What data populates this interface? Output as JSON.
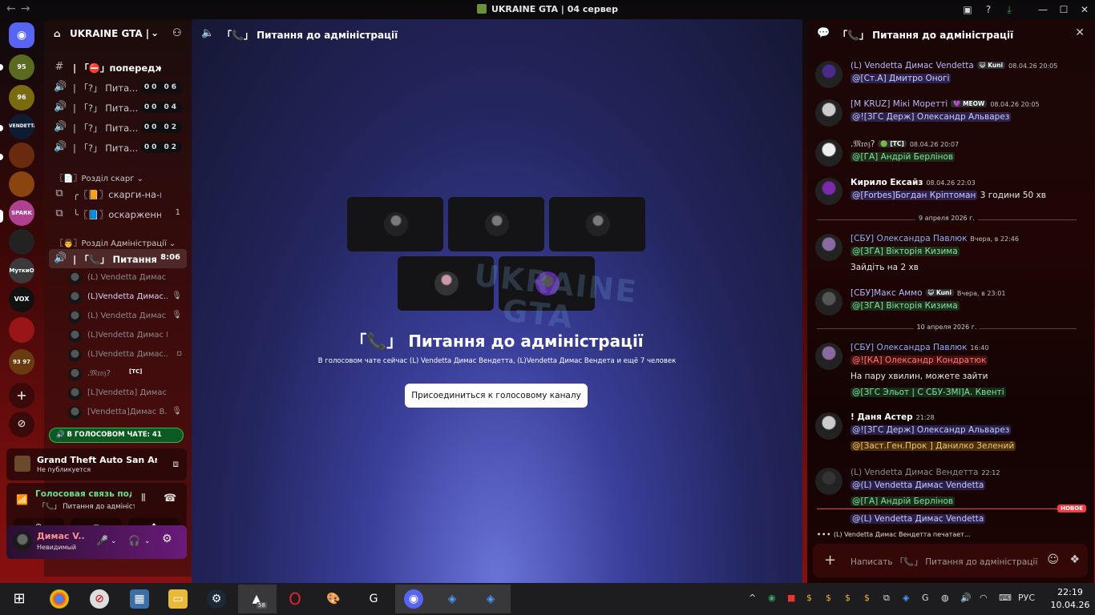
{
  "window": {
    "title": "UKRAINE GTA | 04 сервер",
    "back": "←",
    "forward": "→",
    "min": "—",
    "max": "☐",
    "close": "✕"
  },
  "rail": {
    "servers": [
      "95",
      "96",
      "VENDETTA",
      "",
      "",
      "SPARK",
      "",
      "МуткиО",
      "VOX",
      "",
      "93 97"
    ]
  },
  "guild": {
    "name": "UKRAINE GTA | ..."
  },
  "channels": [
    {
      "icon": "#",
      "label": "| 「⛔」попередження",
      "badge": ""
    },
    {
      "icon": "🔊",
      "label": "| 「?」 Пита...",
      "badge": "00 06"
    },
    {
      "icon": "🔊",
      "label": "| 「?」 Пита...",
      "badge": "00 04"
    },
    {
      "icon": "🔊",
      "label": "| 「?」 Пита...",
      "badge": "00 02"
    },
    {
      "icon": "🔊",
      "label": "| 「?」 Пита...",
      "badge": "00 02"
    }
  ],
  "category1": "〖📄〗Розділ скарг ⌄",
  "threads": [
    {
      "label": "╭〖📙〗скарги-на-гр...",
      "count": ""
    },
    {
      "label": "╰〖📘〗оскарженн...",
      "count": "1"
    }
  ],
  "category2": "〖👨〗Розділ Адміністрації ⌄",
  "active_channel": {
    "label": "| 「📞」 Питання ...",
    "time": "8:06"
  },
  "voice_users": [
    {
      "name": "(L) Vendetta Димас Ве...",
      "status": "",
      "bright": false
    },
    {
      "name": "(L)Vendetta Димас...",
      "status": "🎤̸",
      "bright": true
    },
    {
      "name": "(L) Vendetta Димас Ве...",
      "status": "🎤̸",
      "bright": false
    },
    {
      "name": "(L)Vendetta Димас Вен...",
      "status": "",
      "bright": false
    },
    {
      "name": "(L)Vendetta Димас...",
      "status": "▫",
      "bright": false
    },
    {
      "name": ".𝔐𝔯𝔬𝔷?",
      "status": "",
      "bright": false,
      "tag": "[TC]"
    },
    {
      "name": "[L]Vendetta] Димас Ве...",
      "status": "",
      "bright": false
    },
    {
      "name": "[Vendetta]Димас В...",
      "status": "🎤̸",
      "bright": false
    }
  ],
  "voice_pill": "🔊 В ГОЛОСОВОМ ЧАТЕ: 41",
  "activity": {
    "title": "Grand Theft Auto San Andr...",
    "sub": "Не публикуется"
  },
  "voice_conn": {
    "title": "Голосовая связь подкл...",
    "sub": "「📞」 Питання до адміністр..."
  },
  "user": {
    "name": "Димас V...",
    "status": "Невидимый"
  },
  "main": {
    "header": "「📞」 Питання до адміністрації",
    "title": "「📞」 Питання до адміністрації",
    "desc": "В голосовом чате сейчас (L) Vendetta Димас Вендетта, (L)Vendetta Димас Вендета и ещё 7 человек",
    "join": "Присоединиться к голосовому каналу",
    "watermark_line1": "UKRAINE",
    "watermark_line2": "GTA"
  },
  "chat": {
    "header": "「📞」 Питання до адміністрації",
    "messages": [
      {
        "author": "(L) Vendetta Димас Vendetta",
        "tag": "😺 Kuni",
        "time": "08.04.26 20:05",
        "lines": [
          [
            {
              "t": "@[Ст.А] Дмитро Оногі",
              "k": "mention"
            }
          ]
        ]
      },
      {
        "author": "[M KRUZ] Мікі Моретті",
        "tag": "💜 MEOW",
        "time": "08.04.26 20:05",
        "lines": [
          [
            {
              "t": "@![ЗГС Держ] Олександр Альварез",
              "k": "mention"
            }
          ]
        ]
      },
      {
        "author": ".𝔐𝔯𝔬𝔷?",
        "tag": "🟢 [TC]",
        "time": "08.04.26 20:07",
        "lines": [
          [
            {
              "t": "@[ГА] Андрій Берлінов",
              "k": "green"
            }
          ]
        ]
      },
      {
        "author": "Кирило Ексайз",
        "tag": "",
        "time": "08.04.26 22:03",
        "lines": [
          [
            {
              "t": "@[Forbes]Богдан Кріптоман",
              "k": "mention"
            },
            {
              "t": " 3 години 50 хв",
              "k": "text"
            }
          ]
        ]
      },
      {
        "author": "[СБУ] Олександра Павлюк",
        "tag": "",
        "time": "Вчера, в 22:46",
        "lines": [
          [
            {
              "t": "@[ЗГА] Вікторія Кизима",
              "k": "green"
            }
          ],
          [
            {
              "t": "Зайдіть на 2 хв",
              "k": "text"
            }
          ]
        ]
      },
      {
        "author": "[СБУ]Макс Аммо",
        "tag": "😺 Kuni",
        "time": "Вчера, в 23:01",
        "lines": [
          [
            {
              "t": "@[ЗГА] Вікторія Кизима",
              "k": "green"
            }
          ]
        ]
      },
      {
        "author": "[СБУ] Олександра Павлюк",
        "tag": "",
        "time": "16:40",
        "lines": [
          [
            {
              "t": "@![КА] Олександр Кондратюк",
              "k": "red"
            }
          ],
          [
            {
              "t": "На пару хвилин, можете зайти",
              "k": "text"
            }
          ],
          [
            {
              "t": "@[ЗГС Эльот | С СБУ-ЗМІ]А. Квенті",
              "k": "green"
            }
          ]
        ]
      },
      {
        "author": "! Даня Астер",
        "tag": "",
        "time": "21:28",
        "lines": [
          [
            {
              "t": "@![ЗГС Держ] Олександр Альварез",
              "k": "mention"
            }
          ],
          [
            {
              "t": "@[Заст.Ген.Прок ] Данилко Зелений",
              "k": "yellow"
            }
          ]
        ]
      },
      {
        "author": "(L) Vendetta Димас Вендетта",
        "tag": "",
        "time": "22:12",
        "lines": [
          [
            {
              "t": "@(L) Vendetta Димас Vendetta",
              "k": "mention"
            }
          ],
          [
            {
              "t": "@[ГА] Андрій Берлінов",
              "k": "green"
            }
          ]
        ]
      },
      {
        "author": "",
        "tag": "",
        "time": "",
        "lines": [
          [
            {
              "t": "@(L) Vendetta Димас Vendetta",
              "k": "mention"
            }
          ]
        ]
      }
    ],
    "day1": "9 апреля 2026 г.",
    "day2": "10 апреля 2026 г.",
    "new_label": "НОВОЕ",
    "typing": "(L) Vendetta Димас Вендетта печатает...",
    "placeholder": "Написать 「📞」 Питання до адміністрації"
  },
  "taskbar": {
    "lang": "РУС",
    "time": "22:19",
    "date": "10.04.26",
    "badge": "58"
  },
  "colors": {
    "accent": "#5865f2",
    "brand_red": "#7a0e0e",
    "green": "#23a55a"
  }
}
